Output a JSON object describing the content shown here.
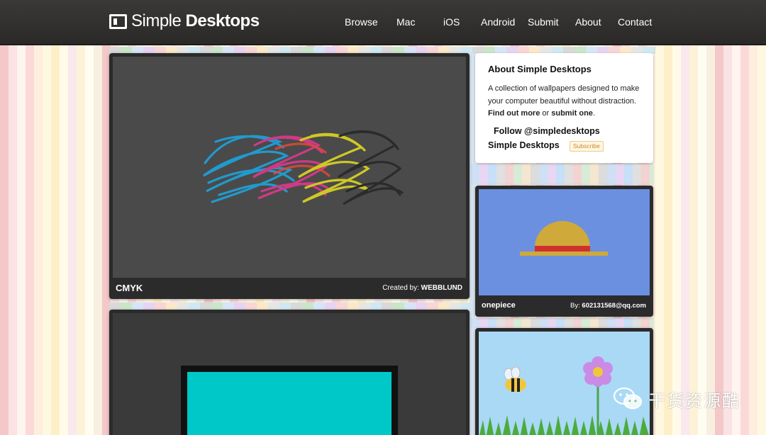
{
  "site": {
    "name_light": "Simple",
    "name_bold": "Desktops"
  },
  "nav": {
    "browse": "Browse",
    "mac": "Mac",
    "ios": "iOS",
    "android": "Android",
    "submit": "Submit",
    "about": "About",
    "contact": "Contact"
  },
  "featured": {
    "title": "CMYK",
    "credit_prefix": "Created by:",
    "author": "WEBBLUND"
  },
  "about_box": {
    "heading": "About Simple Desktops",
    "text": "A collection of wallpapers designed to make your computer beautiful without distraction.",
    "find_more": "Find out more",
    "or": "or",
    "submit_one": "submit one",
    "period": ".",
    "follow": "Follow @simpledesktops",
    "feed_label": "Simple Desktops",
    "subscribe": "Subscribe"
  },
  "side_card_1": {
    "title": "onepiece",
    "credit_prefix": "By:",
    "author": "602131568@qq.com"
  },
  "watermark": {
    "text": "干货资源酷"
  },
  "colors": {
    "header_bg": "#2f2e2c",
    "card_bg": "#2b2b2b",
    "shot_bg_dark": "#4a4a4a",
    "onepiece_bg": "#6b90e0",
    "cyan": "#00c8c8"
  }
}
